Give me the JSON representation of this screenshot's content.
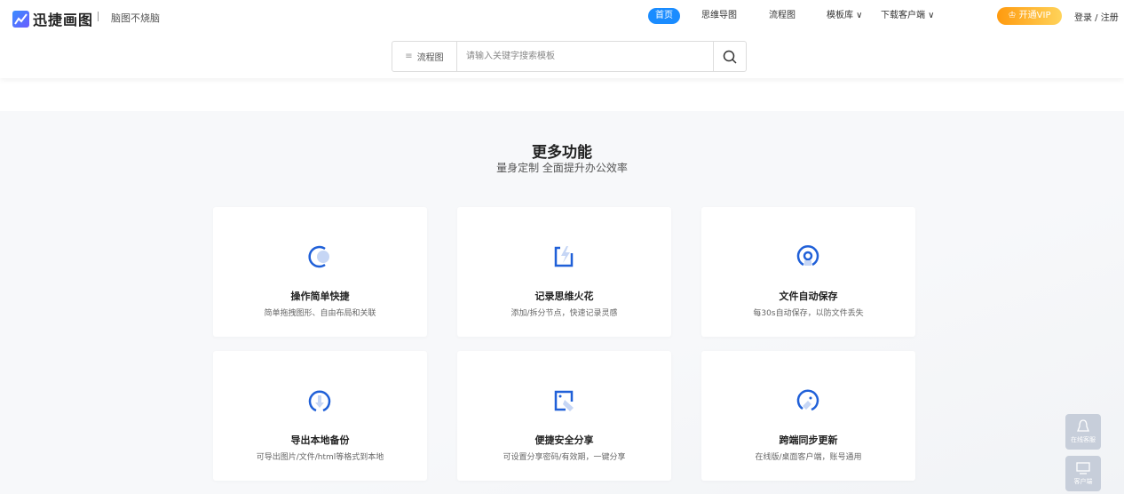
{
  "header": {
    "logo_text": "迅捷画图",
    "slogan": "脑图不烧脑",
    "nav": [
      {
        "label": "首页",
        "active": true
      },
      {
        "label": "思维导图"
      },
      {
        "label": "流程图"
      },
      {
        "label": "模板库 ∨"
      },
      {
        "label": "下载客户端 ∨"
      }
    ],
    "vip_label": "开通VIP",
    "login_label": "登录 / 注册"
  },
  "search": {
    "type_label": "流程图",
    "placeholder": "请输入关键字搜索模板",
    "value": ""
  },
  "section": {
    "title": "更多功能",
    "subtitle": "量身定制 全面提升办公效率",
    "features": [
      {
        "title": "操作简单快捷",
        "desc": "简单拖拽图形、自由布局和关联",
        "icon": "circle-icon"
      },
      {
        "title": "记录思维火花",
        "desc": "添加/拆分节点，快速记录灵感",
        "icon": "lightning-icon"
      },
      {
        "title": "文件自动保存",
        "desc": "每30s自动保存，以防文件丢失",
        "icon": "save-icon"
      },
      {
        "title": "导出本地备份",
        "desc": "可导出图片/文件/html等格式到本地",
        "icon": "export-icon"
      },
      {
        "title": "便捷安全分享",
        "desc": "可设置分享密码/有效期，一键分享",
        "icon": "share-icon"
      },
      {
        "title": "跨端同步更新",
        "desc": "在线版/桌面客户端，账号通用",
        "icon": "sync-icon"
      }
    ]
  },
  "float": {
    "service_label": "在线客服",
    "client_label": "客户端"
  },
  "colors": {
    "accent": "#1a8cff",
    "icon_blue": "#2060d8",
    "vip": "#ff9a0e"
  }
}
